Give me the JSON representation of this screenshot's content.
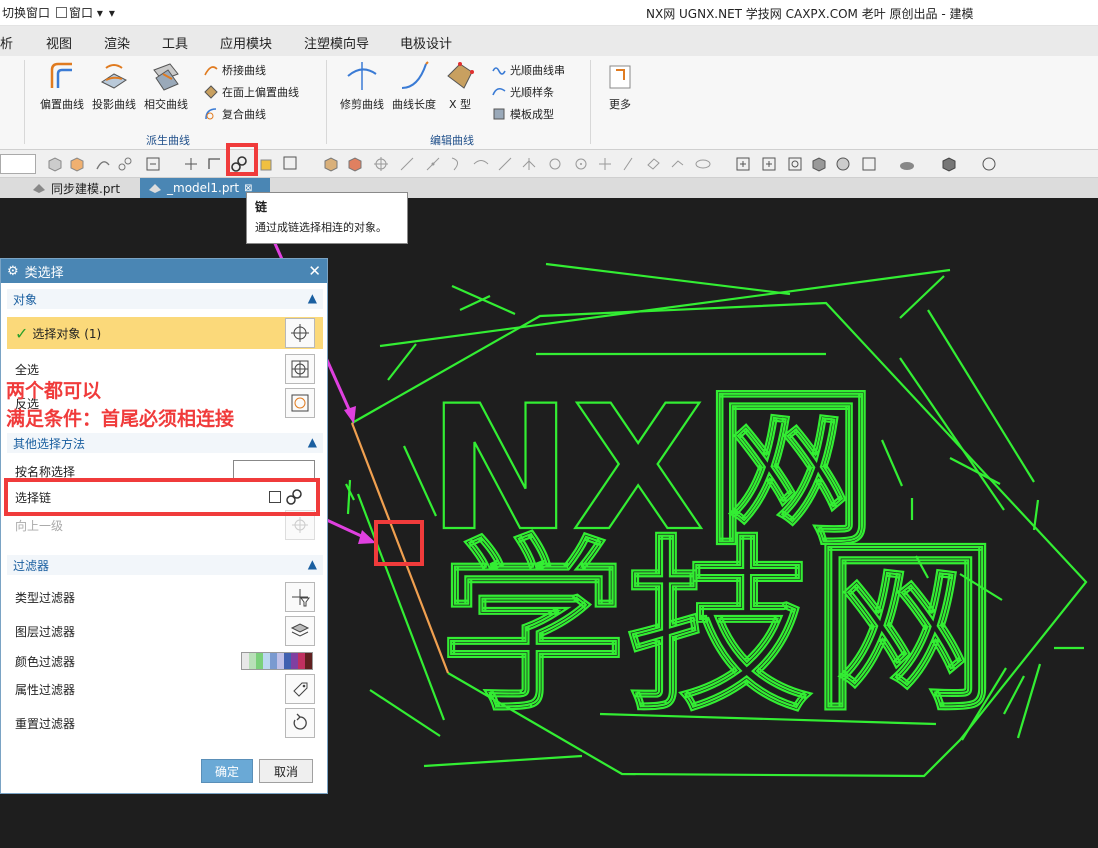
{
  "titlebar": {
    "switch_window": "切换窗口",
    "window_menu": "窗口",
    "title": "NX网 UGNX.NET 学技网 CAXPX.COM 老叶 原创出品 - 建模"
  },
  "menu_tabs": [
    "析",
    "视图",
    "渲染",
    "工具",
    "应用模块",
    "注塑模向导",
    "电极设计"
  ],
  "ribbon": {
    "derived": {
      "offset_curve": "偏置曲线",
      "project_curve": "投影曲线",
      "intersect_curve": "相交曲线",
      "bridge_curve": "桥接曲线",
      "offset_on_face": "在面上偏置曲线",
      "composite_curve": "复合曲线",
      "group_label": "派生曲线"
    },
    "edit": {
      "trim_curve": "修剪曲线",
      "curve_length": "曲线长度",
      "x_form": "X 型",
      "smooth_spline_chain": "光顺曲线串",
      "smooth_spline": "光顺样条",
      "template_shape": "模板成型",
      "group_label": "编辑曲线"
    },
    "more": "更多"
  },
  "file_tabs": {
    "tab1": "同步建模.prt",
    "tab2": "_model1.prt"
  },
  "tooltip": {
    "title": "链",
    "description": "通过成链选择相连的对象。"
  },
  "dialog": {
    "title": "类选择",
    "objects_section": "对象",
    "select_object": "选择对象 (1)",
    "select_all": "全选",
    "invert_select": "反选",
    "other_methods_section": "其他选择方法",
    "select_by_name": "按名称选择",
    "select_chain": "选择链",
    "up_one_level": "向上一级",
    "filters_section": "过滤器",
    "type_filter": "类型过滤器",
    "layer_filter": "图层过滤器",
    "color_filter": "颜色过滤器",
    "attribute_filter": "属性过滤器",
    "reset_filter": "重置过滤器",
    "ok": "确定",
    "cancel": "取消"
  },
  "annotation": {
    "line1": "两个都可以",
    "line2": "满足条件：首尾必须相连接"
  },
  "graphics": {
    "logo_line1": "NX网",
    "logo_line2": "学技网"
  },
  "colors": {
    "accent": "#4a86b4",
    "curve": "#33ee33",
    "selected_curve": "#f0a050",
    "highlight": "#fbd97a",
    "annotation_red": "#f03b3b",
    "arrow_magenta": "#e040e0"
  }
}
